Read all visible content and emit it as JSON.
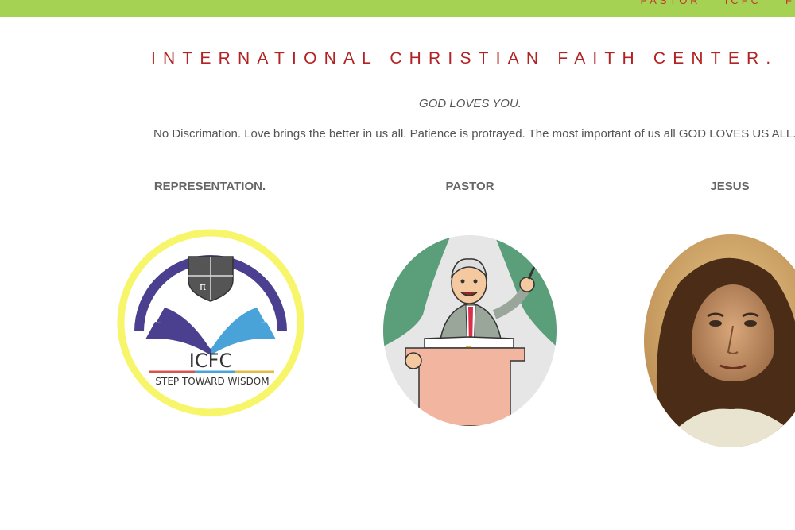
{
  "nav": {
    "items": [
      "PASTOR",
      "ICFC",
      "F"
    ]
  },
  "site": {
    "title": "INTERNATIONAL CHRISTIAN FAITH CENTER.",
    "tagline": "GOD LOVES YOU.",
    "intro": "No Discrimation. Love brings the better in us all. Patience is protrayed. The most important of us all GOD LOVES US ALL."
  },
  "columns": [
    {
      "title": "REPRESENTATION.",
      "logo_text": "ICFC",
      "logo_subtext": "STEP TOWARD WISDOM"
    },
    {
      "title": "PASTOR"
    },
    {
      "title": "JESUS"
    }
  ],
  "colors": {
    "topbar": "#a6d254",
    "title": "#b22222",
    "logo_ring": "#f7f56a",
    "logo_arc": "#4b3f8f",
    "logo_book_blue": "#4aa3d8"
  }
}
